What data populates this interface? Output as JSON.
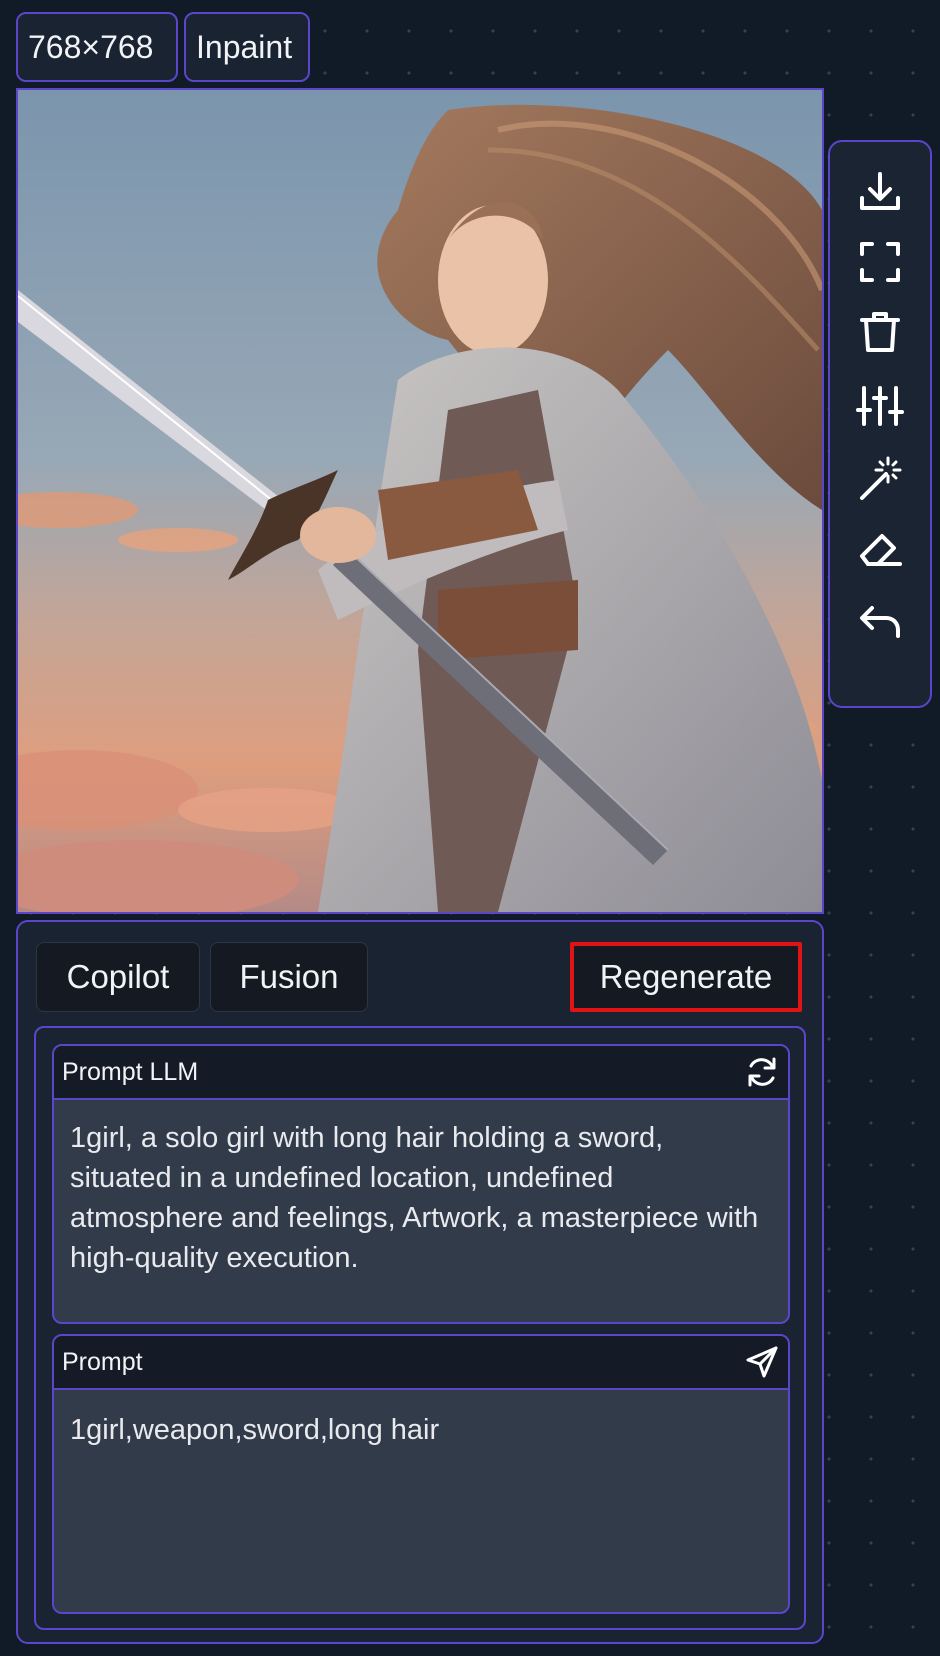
{
  "header": {
    "size_badge": "768×768",
    "mode_badge": "Inpaint"
  },
  "toolbar": {
    "tools": [
      {
        "name": "download-icon"
      },
      {
        "name": "fullscreen-icon"
      },
      {
        "name": "trash-icon"
      },
      {
        "name": "sliders-icon"
      },
      {
        "name": "magic-wand-icon"
      },
      {
        "name": "eraser-icon"
      },
      {
        "name": "undo-icon"
      }
    ]
  },
  "panel": {
    "tabs": {
      "copilot": "Copilot",
      "fusion": "Fusion",
      "regenerate": "Regenerate"
    },
    "prompt_llm": {
      "title": "Prompt LLM",
      "icon": "refresh-icon",
      "text": "1girl, a solo girl with long hair holding a sword, situated in a undefined location, undefined atmosphere and feelings, Artwork, a masterpiece with high-quality execution."
    },
    "prompt": {
      "title": "Prompt",
      "icon": "send-icon",
      "text": "1girl,weapon,sword,long hair"
    }
  },
  "colors": {
    "background": "#111a27",
    "accent_border": "#5b46c9",
    "highlight": "#e01414",
    "panel": "#1a2332",
    "textbox": "#323b4a"
  }
}
